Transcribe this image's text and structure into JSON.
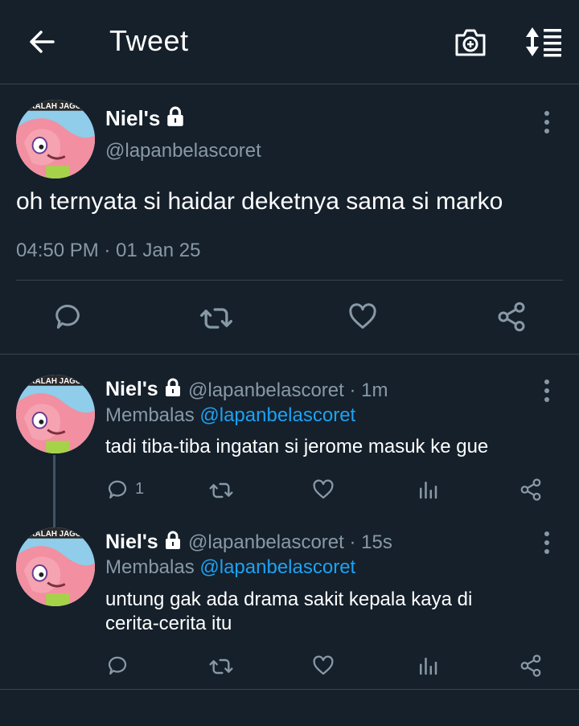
{
  "header": {
    "title": "Tweet"
  },
  "main_tweet": {
    "name": "Niel's",
    "handle": "@lapanbelascoret",
    "text": "oh ternyata si haidar deketnya sama si marko",
    "timestamp": "04:50 PM · 01 Jan 25",
    "avatar_label": "KALAH JAGO"
  },
  "replies": [
    {
      "name": "Niel's",
      "handle_time": "@lapanbelascoret · 1m",
      "replying_prefix": "Membalas",
      "replying_to": "@lapanbelascoret",
      "text": "tadi tiba-tiba ingatan si jerome masuk ke gue",
      "reply_count": "1"
    },
    {
      "name": "Niel's",
      "handle_time": "@lapanbelascoret · 15s",
      "replying_prefix": "Membalas",
      "replying_to": "@lapanbelascoret",
      "text_line1": "untung gak ada drama sakit kepala kaya di",
      "text_line2": "cerita-cerita itu"
    }
  ],
  "colors": {
    "background": "#15202b",
    "muted": "#8899a6",
    "accent": "#1da1f2",
    "divider": "#38444d"
  },
  "icons": [
    "back-arrow-icon",
    "camera-icon",
    "sort-icon",
    "lock-icon",
    "more-vertical-icon",
    "reply-icon",
    "retweet-icon",
    "like-icon",
    "analytics-icon",
    "share-icon"
  ]
}
